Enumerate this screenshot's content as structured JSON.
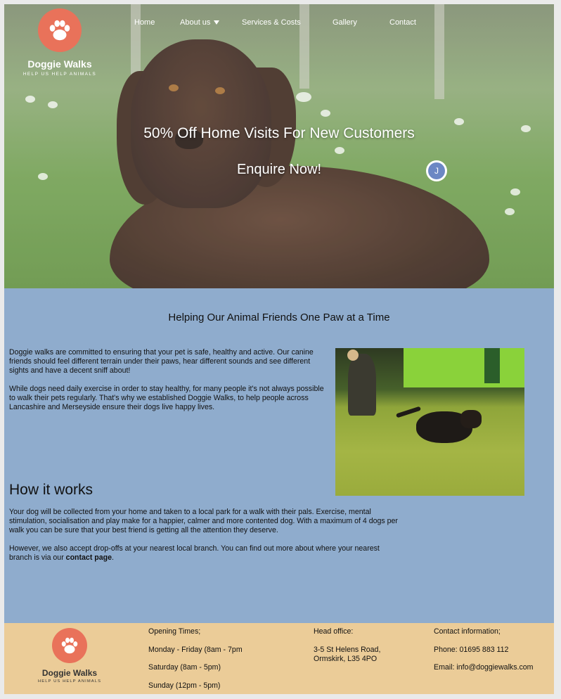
{
  "brand": {
    "name": "Doggie Walks",
    "tagline": "HELP US HELP ANIMALS",
    "accent_color": "#e9725a",
    "logo_icon": "paw-print-icon"
  },
  "nav": {
    "home": "Home",
    "about": "About us",
    "services": "Services & Costs",
    "gallery": "Gallery",
    "contact": "Contact"
  },
  "hero": {
    "headline": "50% Off Home Visits For New Customers",
    "cta": "Enquire Now!",
    "chat_initial": "J"
  },
  "main": {
    "background_color": "#8faccd",
    "title": "Helping Our Animal Friends One Paw at a Time",
    "para1": "Doggie walks are committed to ensuring that your pet is safe, healthy and active. Our canine friends should feel different terrain under their paws, hear different sounds and see different sights and have a decent sniff about!",
    "para2": "While dogs need daily exercise in order to stay healthy, for many people it's not always possible to walk their pets regularly. That's why we established Doggie Walks, to help people across Lancashire and Merseyside ensure their dogs live happy lives.",
    "how_title": "How it works",
    "how_para1": "Your dog will be collected from your home and taken to a local park for a walk with their pals. Exercise, mental stimulation, socialisation and play make for a happier, calmer and more contented dog. With a maximum of 4 dogs per walk you can be sure that your best friend is getting all the attention they deserve.",
    "how_para2_prefix": "However, we also accept drop-offs at your nearest local branch. You can find out more about where your nearest branch is via our ",
    "how_para2_link": "contact page",
    "how_para2_suffix": "."
  },
  "footer": {
    "background_color": "#ebcc98",
    "opening_title": "Opening Times;",
    "opening_weekday": "Monday - Friday (8am - 7pm",
    "opening_saturday": "Saturday (8am - 5pm)",
    "opening_sunday": "Sunday (12pm - 5pm)",
    "office_title": "Head office:",
    "office_line1": "3-5 St Helens Road,",
    "office_line2": "Ormskirk, L35 4PO",
    "contact_title": "Contact information;",
    "contact_phone": "Phone: 01695 883 112",
    "contact_email": "Email: info@doggiewalks.com"
  }
}
